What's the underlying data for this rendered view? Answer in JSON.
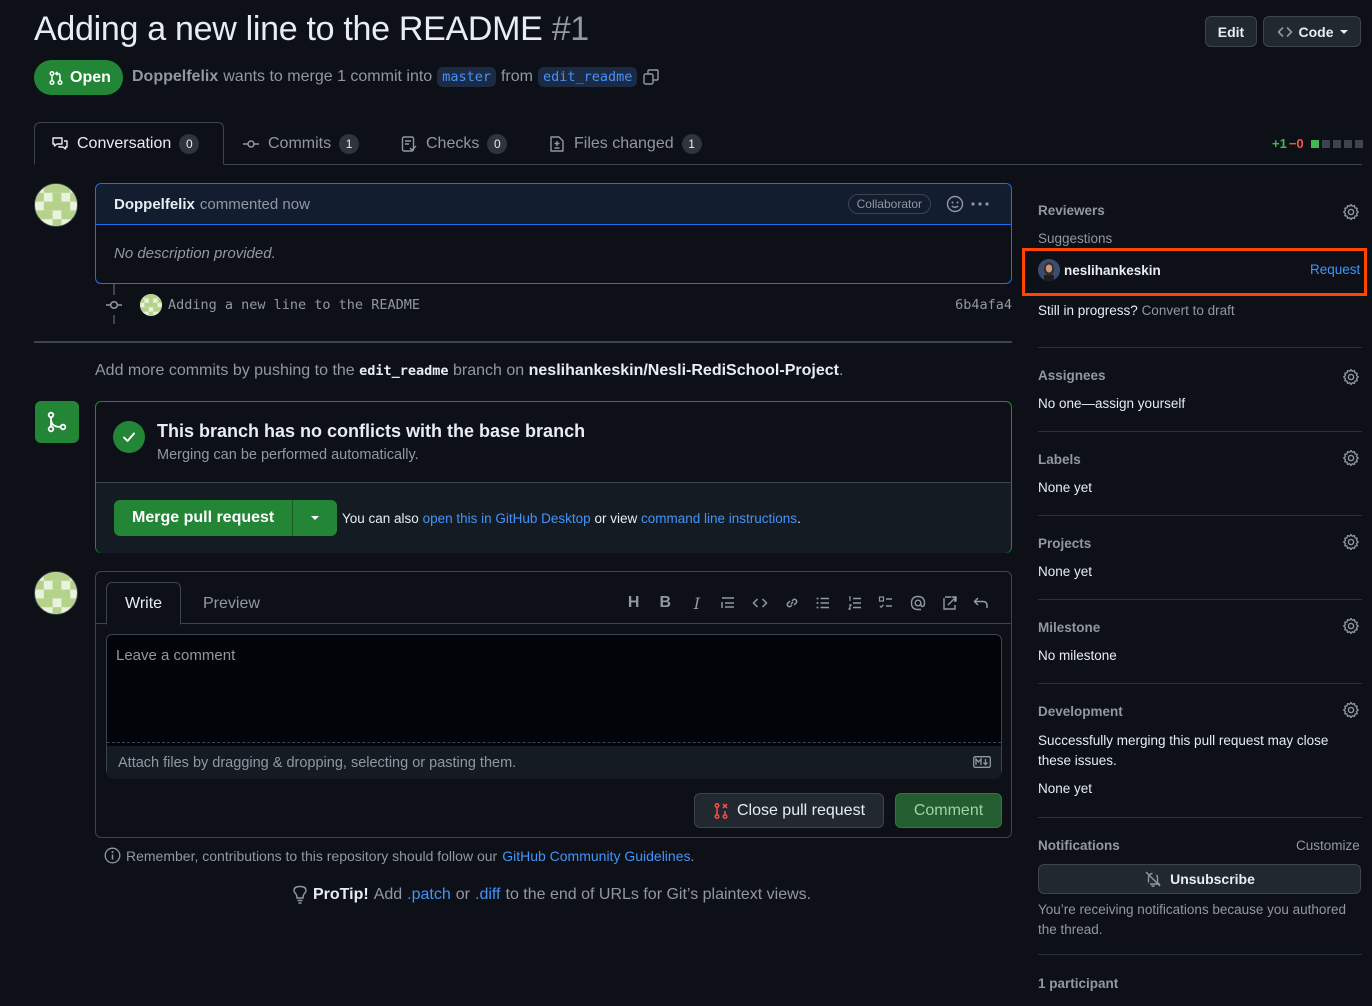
{
  "pr": {
    "title": "Adding a new line to the README",
    "number": "#1",
    "state": "Open",
    "author": "Doppelfelix",
    "merge_text": "wants to merge 1 commit into",
    "base": "master",
    "from_word": "from",
    "head": "edit_readme"
  },
  "header_buttons": {
    "edit": "Edit",
    "code": "Code"
  },
  "tabs": [
    {
      "label": "Conversation",
      "count": "0"
    },
    {
      "label": "Commits",
      "count": "1"
    },
    {
      "label": "Checks",
      "count": "0"
    },
    {
      "label": "Files changed",
      "count": "1"
    }
  ],
  "diffstat": {
    "additions": "+1",
    "deletions": "−0"
  },
  "comment": {
    "author": "Doppelfelix",
    "action": "commented now",
    "badge": "Collaborator",
    "body": "No description provided."
  },
  "commit": {
    "message": "Adding a new line to the README",
    "sha": "6b4afa4"
  },
  "push_hint": {
    "prefix": "Add more commits by pushing to the",
    "branch": "edit_readme",
    "middle": "branch on",
    "repo": "neslihankeskin/Nesli-RediSchool-Project",
    "suffix": "."
  },
  "merge": {
    "title": "This branch has no conflicts with the base branch",
    "subtitle": "Merging can be performed automatically.",
    "button": "Merge pull request",
    "also_prefix": "You can also",
    "desktop_link": "open this in GitHub Desktop",
    "or_view": "or view",
    "cli_link": "command line instructions",
    "period": "."
  },
  "form": {
    "tab_write": "Write",
    "tab_preview": "Preview",
    "placeholder": "Leave a comment",
    "attach": "Attach files by dragging & dropping, selecting or pasting them.",
    "close_button": "Close pull request",
    "comment_button": "Comment",
    "toolbar_icons": [
      "heading-icon",
      "bold-icon",
      "italic-icon",
      "quote-icon",
      "code-icon",
      "link-icon",
      "unordered-list-icon",
      "ordered-list-icon",
      "task-list-icon",
      "mention-icon",
      "reference-icon",
      "undo-icon"
    ]
  },
  "guidelines": {
    "prefix": "Remember, contributions to this repository should follow our",
    "link": "GitHub Community Guidelines",
    "suffix": "."
  },
  "protip": {
    "label": "ProTip!",
    "t1": "Add",
    "patch": ".patch",
    "t2": "or",
    "diff": ".diff",
    "t3": "to the end of URLs for Git’s plaintext views."
  },
  "sidebar": {
    "reviewers": {
      "heading": "Reviewers",
      "suggestions": "Suggestions",
      "suggested_user": "neslihankeskin",
      "request": "Request",
      "draft_prefix": "Still in progress?",
      "draft_link": "Convert to draft"
    },
    "assignees": {
      "heading": "Assignees",
      "value": "No one—assign yourself"
    },
    "labels": {
      "heading": "Labels",
      "value": "None yet"
    },
    "projects": {
      "heading": "Projects",
      "value": "None yet"
    },
    "milestone": {
      "heading": "Milestone",
      "value": "No milestone"
    },
    "development": {
      "heading": "Development",
      "note": "Successfully merging this pull request may close these issues.",
      "value": "None yet"
    },
    "notifications": {
      "heading": "Notifications",
      "customize": "Customize",
      "button": "Unsubscribe",
      "note": "You’re receiving notifications because you authored the thread."
    },
    "participants": "1 participant"
  },
  "colors": {
    "accent": "#4493f8",
    "success": "#238636",
    "highlight": "#ff4500",
    "background": "#0d1117"
  }
}
